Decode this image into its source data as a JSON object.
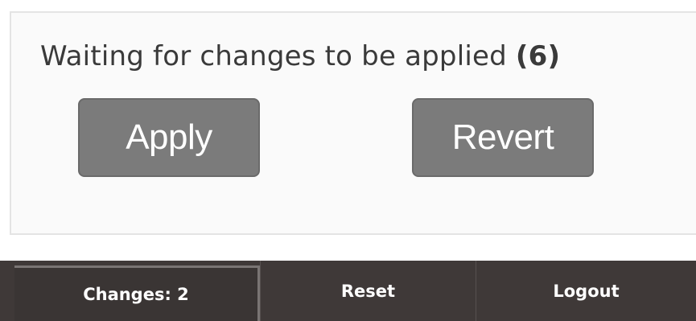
{
  "status": {
    "message": "Waiting for changes to be applied",
    "count": "(6)"
  },
  "actions": {
    "apply_label": "Apply",
    "revert_label": "Revert"
  },
  "nav": {
    "items": [
      {
        "label": "Changes: 2"
      },
      {
        "label": "Reset"
      },
      {
        "label": "Logout"
      }
    ]
  },
  "colors": {
    "button_bg": "#7b7b7b",
    "navbar_bg": "#3f3938",
    "text": "#3a3a3a"
  }
}
